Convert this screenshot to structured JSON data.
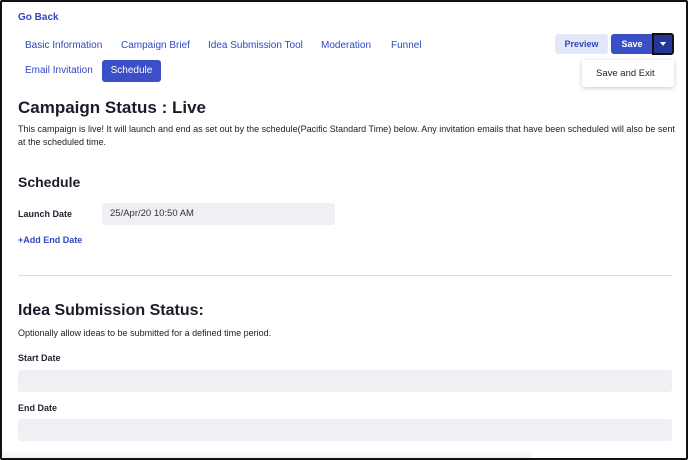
{
  "nav": {
    "go_back": "Go Back"
  },
  "tabs": [
    {
      "label": "Basic Information",
      "active": false
    },
    {
      "label": "Campaign Brief",
      "active": false
    },
    {
      "label": "Idea Submission Tool",
      "active": false
    },
    {
      "label": "Moderation",
      "active": false
    },
    {
      "label": "Funnel",
      "active": false
    },
    {
      "label": "Email Invitation",
      "active": false
    },
    {
      "label": "Schedule",
      "active": true
    }
  ],
  "toolbar": {
    "preview_label": "Preview",
    "save_label": "Save",
    "dropdown_icon": "caret-down-icon",
    "dropdown_items": [
      "Save and Exit"
    ]
  },
  "campaign_status": {
    "title": "Campaign Status : Live",
    "description": "This campaign is live! It will launch and end as set out by the schedule(Pacific Standard Time) below. Any invitation emails that have been scheduled will also be sent at the scheduled time."
  },
  "schedule": {
    "title": "Schedule",
    "launch_date_label": "Launch Date",
    "launch_date_value": "25/Apr/20 10:50 AM",
    "add_end_date": "+Add End Date"
  },
  "idea_submission": {
    "title": "Idea Submission Status:",
    "description": "Optionally allow ideas to be submitted for a defined time period.",
    "start_date_label": "Start Date",
    "start_date_value": "",
    "end_date_label": "End Date",
    "end_date_value": ""
  },
  "colors": {
    "accent": "#3b4fc7",
    "accent_dark": "#243796",
    "link": "#2f47c2",
    "field_bg": "#eef0f3"
  }
}
